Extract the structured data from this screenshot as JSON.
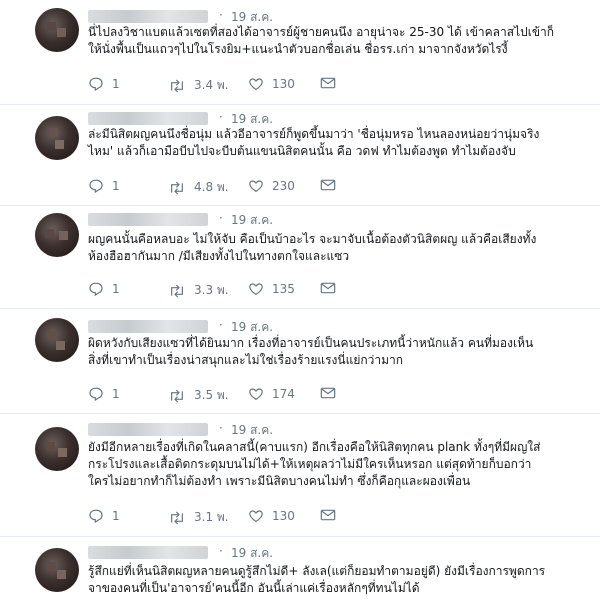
{
  "tweets": [
    {
      "date": "19 ส.ค.",
      "lines": [
        "นี่ไปลงวิชาแบตแล้วเซตที่สองได้อาจารย์ผู้ชายคนนึง อายุน่าจะ 25-30 ได้ เข้าคลาสไปเข้าก็",
        "ให้นั่งพื้นเป็นแถวๆไปในโรงยิม+แนะนำตัวบอกชื่อเล่น ชื่อรร.เก่า มาจากจังหวัดไรงี้"
      ],
      "replies": "1",
      "retweets": "3.4 พ.",
      "likes": "130"
    },
    {
      "date": "19 ส.ค.",
      "lines": [
        "ล่ะมีนิสิตผญคนนึงชื่อนุ่ม แล้วอีอาจารย์ก็พูดขึ้นมาว่า 'ชื่อนุ่มหรอ ไหนลองหน่อยว่านุ่มจริง",
        "ไหม' แล้วก็เอามือบีบไปจะบีบต้นแขนนิสิตคนนั้น คือ วดฟ ทำไมต้องพูด ทำไมต้องจับ"
      ],
      "replies": "1",
      "retweets": "4.8 พ.",
      "likes": "230"
    },
    {
      "date": "19 ส.ค.",
      "lines": [
        "ผญคนนั้นคือหลบอะ ไม่ให้จับ คือเป็นบ้าอะไร จะมาจับเนื้อต้องตัวนิสิตผญ แล้วคือเสียงทั้ง",
        "ห้องฮือฮากันมาก /มีเสียงทั้งไปในทางตกใจและแซว"
      ],
      "replies": "1",
      "retweets": "3.3 พ.",
      "likes": "135"
    },
    {
      "date": "19 ส.ค.",
      "lines": [
        "ผิดหวังกับเสียงแซวที่ได้ยินมาก เรื่องที่อาจารย์เป็นคนประเภทนี้ว่าหนักแล้ว คนที่มองเห็น",
        "สิ่งที่เขาทำเป็นเรื่องน่าสนุกและไม่ใช่เรื่องร้ายแรงนี่แย่กว่ามาก"
      ],
      "replies": "1",
      "retweets": "3.5 พ.",
      "likes": "174"
    },
    {
      "date": "19 ส.ค.",
      "lines": [
        "ยังมีอีกหลายเรื่องที่เกิดในคลาสนี้(คาบแรก) อีกเรื่องคือให้นิสิตทุกคน plank ทั้งๆที่มีผญใส่",
        "กระโปรงและเสื้อติดกระดุมบนไม่ได้+ให้เหตุผลว่าไม่มีใครเห็นหรอก แต่สุดท้ายก็บอกว่า",
        "ใครไม่อยากทำก็ไม่ต้องทำ เพราะมีนิสิตบางคนไม่ทำ ซึ่งก็คือกุและผองเพื่อน"
      ],
      "replies": "1",
      "retweets": "3.1 พ.",
      "likes": "130"
    },
    {
      "date": "19 ส.ค.",
      "lines": [
        "รู้สึกแย่ที่เห็นนิสิตผญหลายคนดูรู้สึกไม่ดี+ ลังเล(แต่ก็ยอมทำตามอยู่ดี) ยังมีเรื่องการพูดการ",
        "จาของคนที่เป็น'อาจารย์'คนนี้อีก อันนี้เล่าแค่เรื่องหลักๆที่ทนไม่ได้"
      ],
      "replies": "",
      "retweets": "",
      "likes": ""
    }
  ],
  "icons": {
    "reply": "reply-icon",
    "retweet": "retweet-icon",
    "like": "heart-icon",
    "dm": "envelope-icon"
  },
  "colors": {
    "text": "#14171a",
    "muted": "#657786",
    "divider": "#e6ecf0"
  }
}
